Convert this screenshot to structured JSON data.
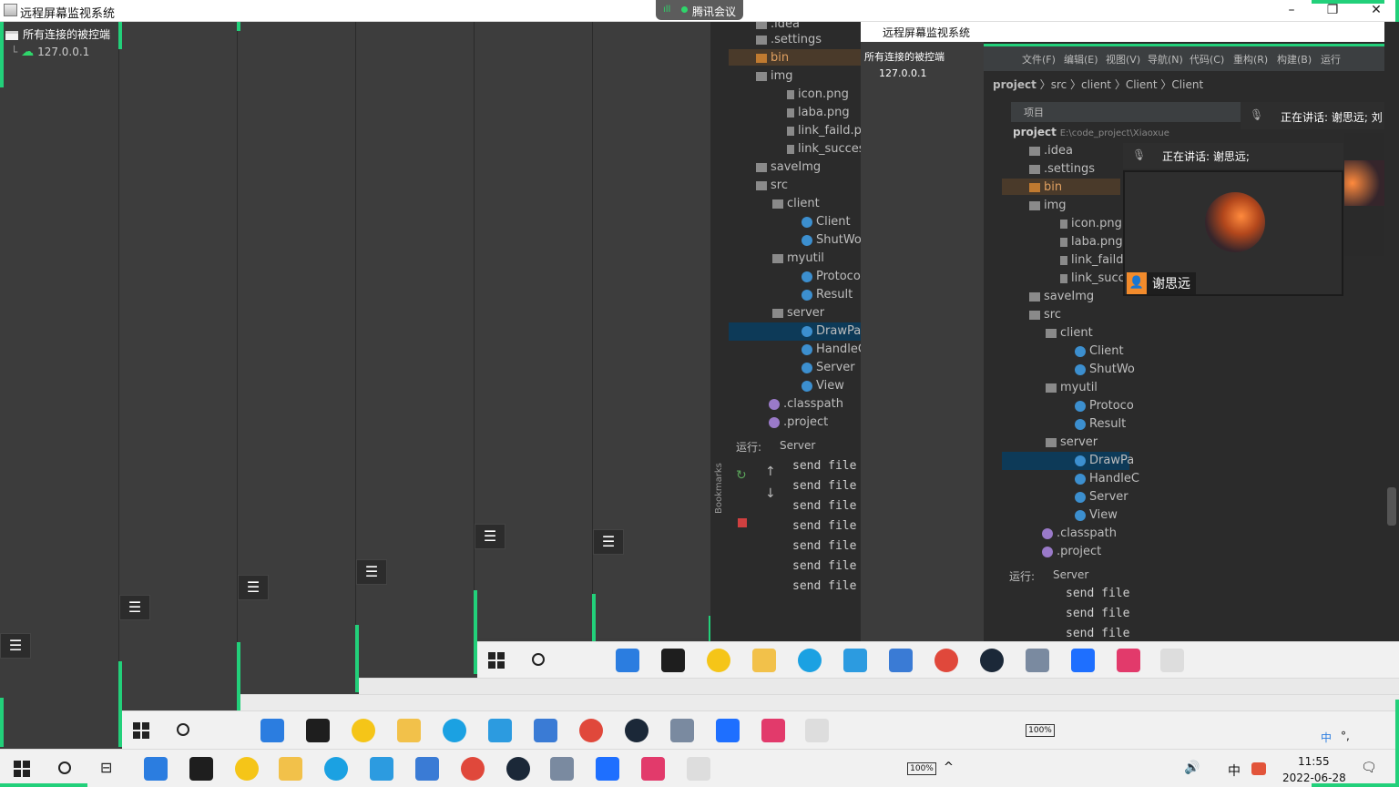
{
  "window": {
    "title": "远程屏幕监视系统",
    "minimize_label": "–",
    "maximize_label": "❐",
    "close_label": "✕"
  },
  "meeting": {
    "label": "腾讯会议",
    "signal": "ıll"
  },
  "tree": {
    "root_label": "所有连接的被控端",
    "client_label": "127.0.0.1"
  },
  "menu_icon": "☰",
  "ide": {
    "project_items": [
      ".idea",
      ".settings",
      "bin",
      "img",
      "icon.png",
      "laba.png",
      "link_faild.p",
      "link_succes",
      "saveImg",
      "src",
      "client",
      "Client",
      "ShutWo",
      "myutil",
      "Protoco",
      "Result",
      "server",
      "DrawPa",
      "HandleC",
      "Server",
      "View",
      ".classpath",
      ".project"
    ],
    "run_label": "运行:",
    "run_tab": "Server",
    "console_line": "send file",
    "bookmarks_label": "Bookmarks"
  },
  "remote": {
    "title": "远程屏幕监视系统",
    "tree_root": "所有连接的被控端",
    "tree_client": "127.0.0.1",
    "menubar": [
      "文件(F)",
      "编辑(E)",
      "视图(V)",
      "导航(N)",
      "代码(C)",
      "重构(R)",
      "构建(B)",
      "运行"
    ],
    "breadcrumb": [
      "project",
      "src",
      "client",
      "Client",
      "Client"
    ],
    "project_label": "项目",
    "project_root": "project",
    "project_path": "E:\\code_project\\Xiaoxue",
    "run_label": "运行:",
    "run_tab": "Server"
  },
  "meeting_video": {
    "speaking_text": "正在讲话: 谢思远;",
    "speaking_text_2": "正在讲话: 谢思远; 刘",
    "participant": "谢思远"
  },
  "taskbar": {
    "battery": "100%",
    "time": "11:55",
    "date": "2022-06-28",
    "ime": "中",
    "ime_punct": "°,"
  },
  "colors": {
    "accent_green": "#22d07a",
    "app_bg": "#3c3c3c",
    "ide_bg": "#2b2b2b",
    "selection": "#0d3a58",
    "taskbar_bg": "#f1f1f1"
  }
}
